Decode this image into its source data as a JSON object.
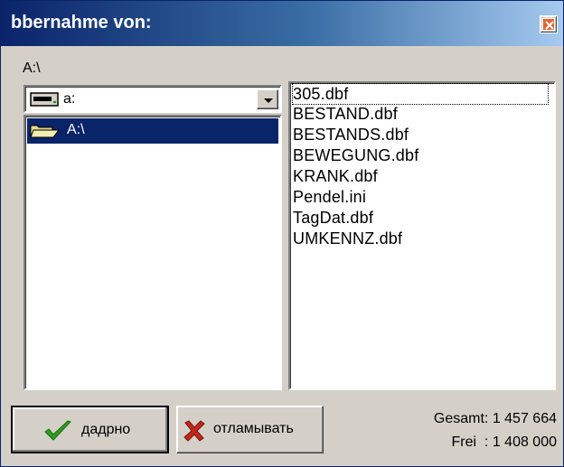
{
  "window": {
    "title": "bbernahme von:",
    "close_icon": "close-icon"
  },
  "path_label": "A:\\",
  "drive_combo": {
    "value": "a:",
    "icon": "floppy-drive-icon"
  },
  "directory_list": {
    "items": [
      {
        "label": "A:\\",
        "icon": "open-folder-icon",
        "selected": true
      }
    ]
  },
  "file_list": {
    "items": [
      "305.dbf",
      "BESTAND.dbf",
      "BESTANDS.dbf",
      "BEWEGUNG.dbf",
      "KRANK.dbf",
      "Pendel.ini",
      "TagDat.dbf",
      "UMKENNZ.dbf"
    ]
  },
  "buttons": {
    "ok_label": "дадрно",
    "ok_icon": "checkmark-icon",
    "cancel_label": "отламывать",
    "cancel_icon": "x-icon"
  },
  "stats": {
    "total": "Gesamt: 1 457 664",
    "free": "Frei  : 1 408 000"
  },
  "colors": {
    "title_gradient_start": "#0a246a",
    "title_gradient_end": "#a6caf0",
    "selection": "#0a246a",
    "face": "#d4d0c8",
    "close_button": "#e8632a",
    "check_green": "#2e9e1e",
    "x_red": "#c0271a"
  }
}
